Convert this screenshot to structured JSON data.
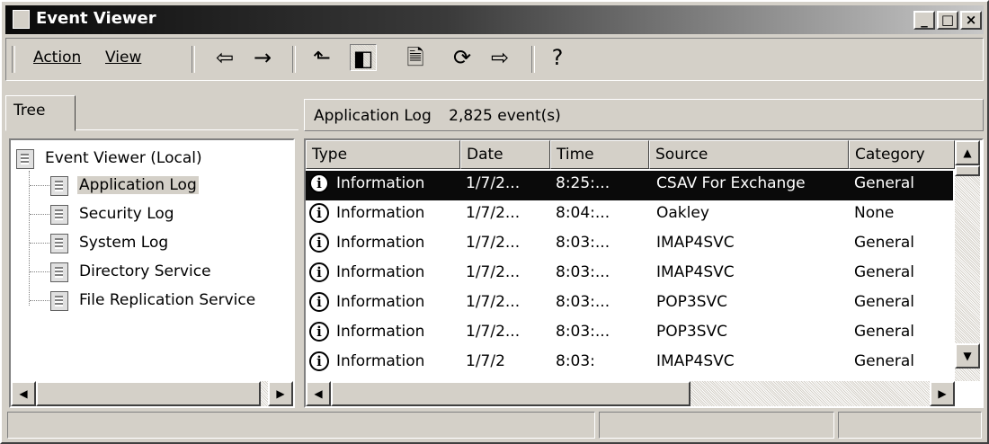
{
  "window": {
    "title": "Event Viewer"
  },
  "menu": {
    "action": "Action",
    "view": "View"
  },
  "toolbar": {
    "buttons": [
      {
        "name": "back-arrow",
        "glyph": "⇦"
      },
      {
        "name": "forward-arrow",
        "glyph": "→"
      },
      {
        "name": "up-one-level",
        "glyph": "⬑"
      },
      {
        "name": "show-hide-tree",
        "glyph": "◧"
      },
      {
        "name": "properties",
        "glyph": "🗎"
      },
      {
        "name": "refresh",
        "glyph": "⟳"
      },
      {
        "name": "export-list",
        "glyph": "⇨"
      },
      {
        "name": "help",
        "glyph": "?"
      }
    ]
  },
  "tree": {
    "tab_label": "Tree",
    "root": "Event Viewer (Local)",
    "items": [
      "Application Log",
      "Security Log",
      "System Log",
      "Directory Service",
      "File Replication Service"
    ],
    "selected": "Application Log"
  },
  "log": {
    "name": "Application Log",
    "count": "2,825 event(s)",
    "columns": [
      "Type",
      "Date",
      "Time",
      "Source",
      "Category"
    ],
    "rows": [
      {
        "type": "Information",
        "date": "1/7/2...",
        "time": "8:25:...",
        "source": "CSAV For Exchange",
        "category": "General",
        "selected": true
      },
      {
        "type": "Information",
        "date": "1/7/2...",
        "time": "8:04:...",
        "source": "Oakley",
        "category": "None"
      },
      {
        "type": "Information",
        "date": "1/7/2...",
        "time": "8:03:...",
        "source": "IMAP4SVC",
        "category": "General"
      },
      {
        "type": "Information",
        "date": "1/7/2...",
        "time": "8:03:...",
        "source": "IMAP4SVC",
        "category": "General"
      },
      {
        "type": "Information",
        "date": "1/7/2...",
        "time": "8:03:...",
        "source": "POP3SVC",
        "category": "General"
      },
      {
        "type": "Information",
        "date": "1/7/2...",
        "time": "8:03:...",
        "source": "POP3SVC",
        "category": "General"
      },
      {
        "type": "Information",
        "date": "1/7/2",
        "time": "8:03:",
        "source": "IMAP4SVC",
        "category": "General"
      }
    ]
  },
  "caption_buttons": {
    "minimize": "_",
    "maximize": "□",
    "close": "×"
  },
  "scroll_glyphs": {
    "left": "◀",
    "right": "▶",
    "up": "▲",
    "down": "▼"
  },
  "colors": {
    "selection": "#0a0a0a",
    "face": "#d4d0c8",
    "titlebar_start": "#0a0a0a"
  }
}
